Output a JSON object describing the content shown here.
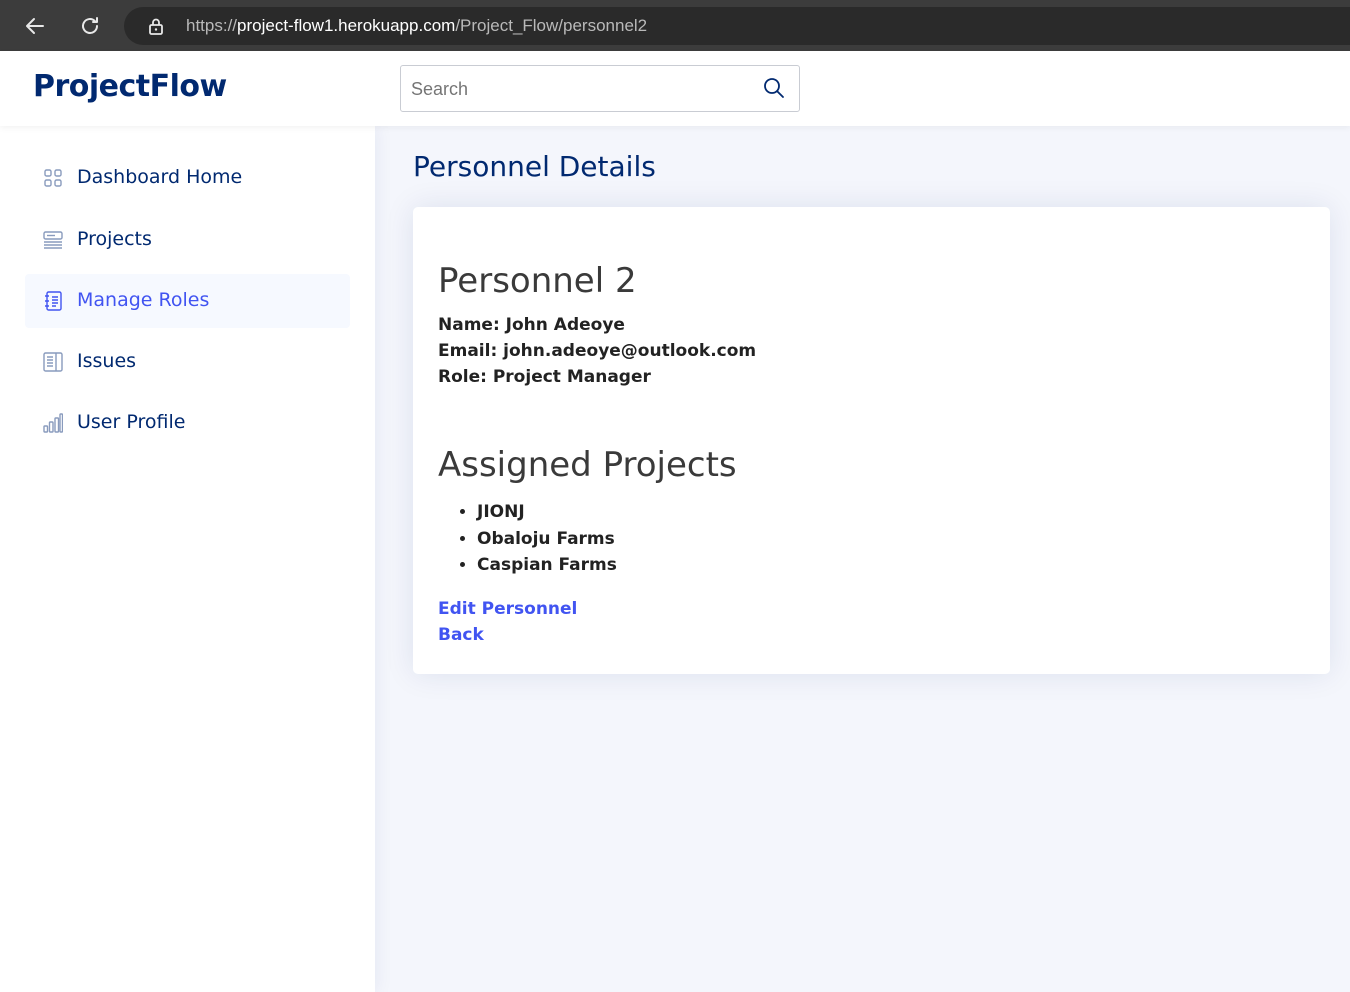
{
  "browser": {
    "url_scheme": "https://",
    "url_host": "project-flow1.herokuapp.com",
    "url_path": "/Project_Flow/personnel2"
  },
  "header": {
    "brand": "ProjectFlow",
    "search_placeholder": "Search"
  },
  "sidebar": {
    "items": [
      {
        "label": "Dashboard Home",
        "icon": "grid-icon"
      },
      {
        "label": "Projects",
        "icon": "menu-button-icon"
      },
      {
        "label": "Manage Roles",
        "icon": "journal-text-icon",
        "active": true
      },
      {
        "label": "Issues",
        "icon": "layout-text-sidebar-icon"
      },
      {
        "label": "User Profile",
        "icon": "bar-chart-icon"
      }
    ]
  },
  "main": {
    "page_title": "Personnel Details",
    "personnel_heading": "Personnel 2",
    "name": "Name: John Adeoye",
    "email": "Email: john.adeoye@outlook.com",
    "role": "Role: Project Manager",
    "assigned_heading": "Assigned Projects",
    "projects": [
      "JIONJ",
      "Obaloju Farms",
      "Caspian Farms"
    ],
    "edit_link": "Edit Personnel",
    "back_link": "Back"
  },
  "colors": {
    "brand": "#012970",
    "accent": "#4154f1",
    "background": "#f4f6fc"
  }
}
